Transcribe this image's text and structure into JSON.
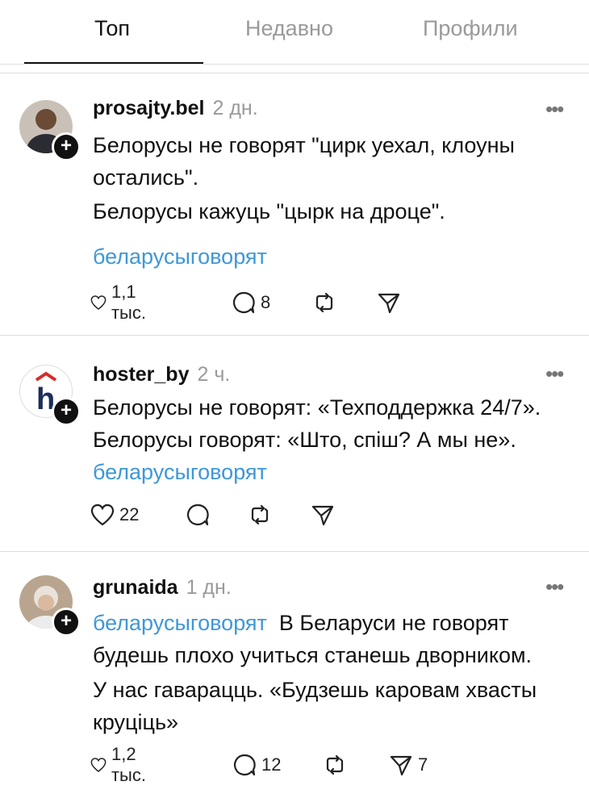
{
  "tabs": [
    {
      "label": "Топ",
      "active": true
    },
    {
      "label": "Недавно",
      "active": false
    },
    {
      "label": "Профили",
      "active": false
    }
  ],
  "posts": [
    {
      "username": "prosajty.bel",
      "time": "2 дн.",
      "paragraphs": [
        "Белорусы не говорят \"цирк уехал, клоуны остались\".",
        "Белорусы кажуць \"цырк на дроце\"."
      ],
      "hashtag": "беларусыговорят",
      "likes": "1,1 тыс.",
      "comments": "8",
      "shares": ""
    },
    {
      "username": "hoster_by",
      "time": "2 ч.",
      "text": "Белорусы не говорят: «Техподдержка 24/7». Белорусы говорят: «Што, спіш? А мы не».",
      "hashtag": "беларусыговорят",
      "likes": "22",
      "comments": "",
      "shares": ""
    },
    {
      "username": "grunaida",
      "time": "1 дн.",
      "hashtag": "беларусыговорят",
      "text": "В Беларуси не говорят будешь плохо учиться станешь дворником.",
      "text2": "У нас гаварацць. «Будзешь каровам хвасты круціць»",
      "likes": "1,2 тыс.",
      "comments": "12",
      "shares": "7"
    }
  ],
  "icons": {
    "more": "more-icon",
    "like": "heart-icon",
    "comment": "comment-icon",
    "repost": "repost-icon",
    "share": "share-icon",
    "follow": "plus-icon"
  },
  "colors": {
    "hashtag": "#3f97d8",
    "muted": "#9a9a9a",
    "text": "#111111"
  }
}
